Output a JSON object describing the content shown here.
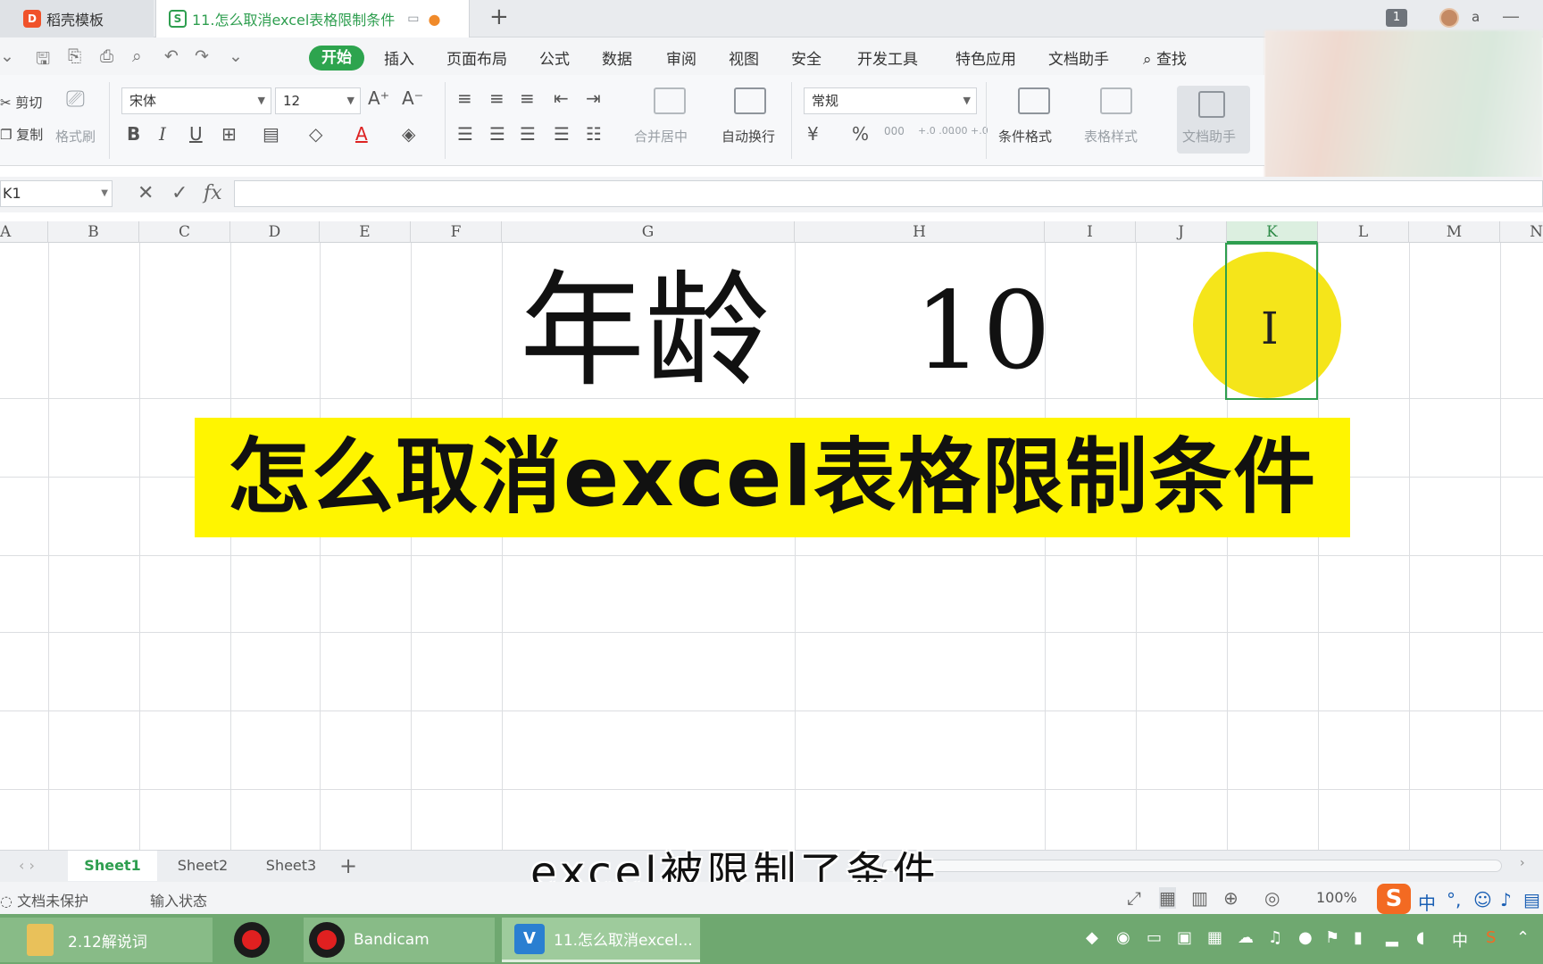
{
  "tabs": {
    "home_tab": "稻壳模板",
    "doc_tab": "11.怎么取消excel表格限制条件",
    "add": "+",
    "notif_count": "1",
    "user": "a"
  },
  "menu": {
    "items": [
      "开始",
      "插入",
      "页面布局",
      "公式",
      "数据",
      "审阅",
      "视图",
      "安全",
      "开发工具",
      "特色应用",
      "文档助手"
    ],
    "search": "查找"
  },
  "ribbon": {
    "cut": "剪切",
    "copy": "复制",
    "format_painter": "格式刷",
    "font": "宋体",
    "font_size": "12",
    "grow_font": "A⁺",
    "shrink_font": "A⁻",
    "bold": "B",
    "italic": "I",
    "underline": "U",
    "font_color": "A",
    "merge_center": "合并居中",
    "wrap_text": "自动换行",
    "number_format": "常规",
    "percent": "%",
    "thousands": "000",
    "inc_decimal": "+.0 .00",
    "dec_decimal": ".00 +.0",
    "cond_format": "条件格式",
    "table_style": "表格样式",
    "doc_assistant": "文档助手"
  },
  "formula_bar": {
    "name_box": "K1",
    "cancel": "✕",
    "confirm": "✓",
    "fx": "fx",
    "value": ""
  },
  "columns": [
    "A",
    "B",
    "C",
    "D",
    "E",
    "F",
    "G",
    "H",
    "I",
    "J",
    "K",
    "L",
    "M",
    "N"
  ],
  "selected_column": "K",
  "cells": {
    "label": "年龄",
    "value": "10"
  },
  "banner": "怎么取消excel表格限制条件",
  "subtitle": "excel被限制了条件",
  "sheets": [
    "Sheet1",
    "Sheet2",
    "Sheet3"
  ],
  "active_sheet": "Sheet1",
  "status": {
    "protection": "文档未保护",
    "input_state": "输入状态",
    "zoom": "100%"
  },
  "ime": {
    "lang": "中",
    "punct": "°,",
    "tray_lang": "中"
  },
  "taskbar": {
    "folder": "2.12解说词",
    "bandicam": "Bandicam",
    "wps": "11.怎么取消excel..."
  },
  "colors": {
    "accent_green": "#2da44e",
    "banner_yellow": "#fff500",
    "highlight_yellow": "#f5e51a",
    "taskbar": "#6fa870"
  }
}
